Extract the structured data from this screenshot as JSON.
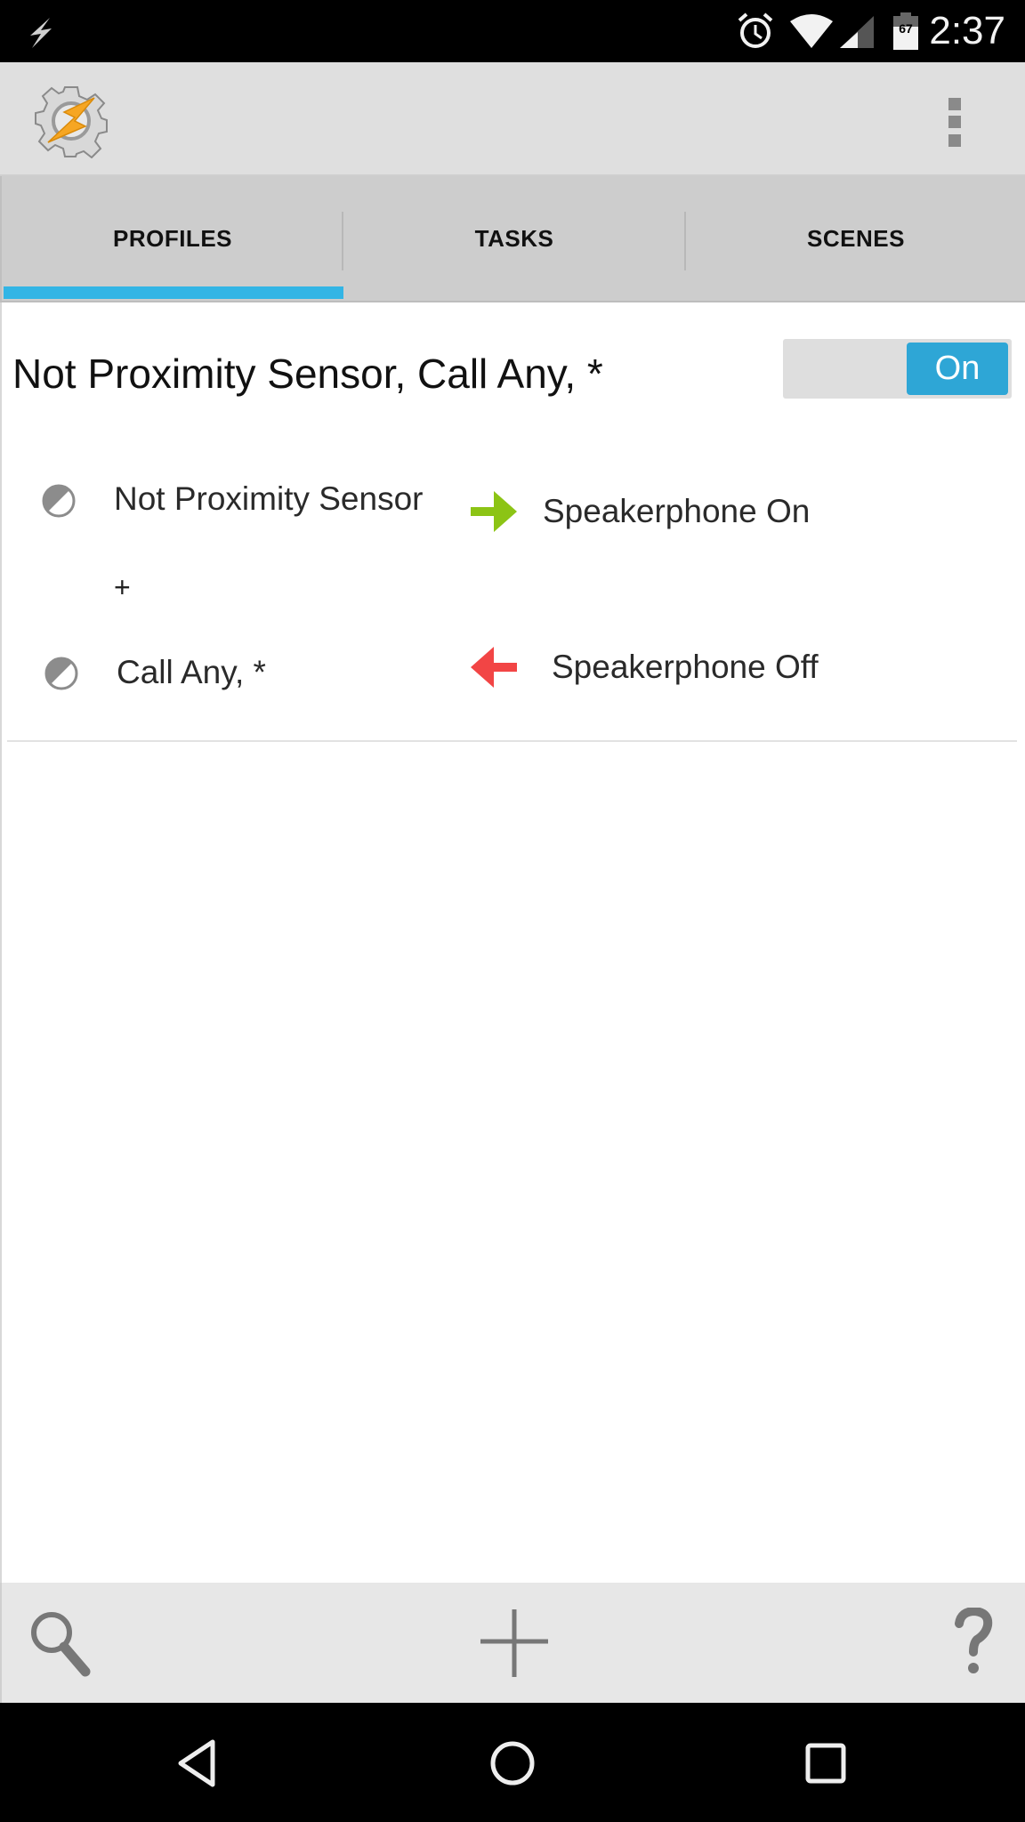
{
  "status_bar": {
    "notification_icon": "flash-icon",
    "icons": [
      "alarm-icon",
      "wifi-icon",
      "cell-signal-icon",
      "battery-icon"
    ],
    "battery_level": "67",
    "time": "2:37"
  },
  "app_bar": {
    "logo_icon": "tasker-gear-bolt-icon",
    "overflow_icon": "more-vert-icon"
  },
  "tabs": [
    {
      "label": "PROFILES",
      "selected": true
    },
    {
      "label": "TASKS",
      "selected": false
    },
    {
      "label": "SCENES",
      "selected": false
    }
  ],
  "colors": {
    "accent": "#33b5e5",
    "toggle_on": "#2ea6d6",
    "enter_arrow": "#8cc415",
    "exit_arrow": "#f24545"
  },
  "profile": {
    "title": "Not Proximity Sensor, Call Any, *",
    "toggle_label": "On",
    "toggle_state": true,
    "contexts": [
      {
        "label": "Not Proximity Sensor",
        "icon": "state-icon"
      },
      {
        "label": "Call Any, *",
        "icon": "state-icon"
      }
    ],
    "context_joiner": "+",
    "enter_task": {
      "label": "Speakerphone On",
      "icon": "enter-arrow-icon"
    },
    "exit_task": {
      "label": "Speakerphone Off",
      "icon": "exit-arrow-icon"
    }
  },
  "bottom_bar": {
    "search_icon": "search-icon",
    "add_icon": "add-icon",
    "help_icon": "help-icon"
  },
  "nav_bar": {
    "back_icon": "back-icon",
    "home_icon": "home-icon",
    "recents_icon": "recents-icon"
  }
}
